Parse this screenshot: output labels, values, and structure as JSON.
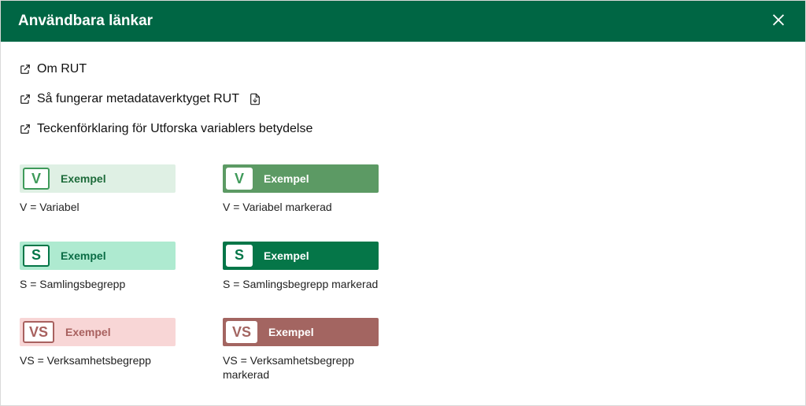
{
  "header": {
    "title": "Användbara länkar"
  },
  "links": [
    {
      "label": "Om RUT",
      "has_pdf": false
    },
    {
      "label": "Så fungerar metadataverktyget RUT",
      "has_pdf": true
    },
    {
      "label": "Teckenförklaring för Utforska variablers betydelse",
      "has_pdf": false
    }
  ],
  "legend": {
    "rows": [
      {
        "key": "v",
        "normal": {
          "letter": "V",
          "example": "Exempel",
          "caption": "V = Variabel"
        },
        "selected": {
          "letter": "V",
          "example": "Exempel",
          "caption": "V = Variabel markerad"
        }
      },
      {
        "key": "s",
        "normal": {
          "letter": "S",
          "example": "Exempel",
          "caption": "S = Samlingsbegrepp"
        },
        "selected": {
          "letter": "S",
          "example": "Exempel",
          "caption": "S = Samlingsbegrepp markerad"
        }
      },
      {
        "key": "vs",
        "normal": {
          "letter": "VS",
          "example": "Exempel",
          "caption": "VS = Verksamhetsbegrepp"
        },
        "selected": {
          "letter": "VS",
          "example": "Exempel",
          "caption": "VS = Verksamhetsbegrepp markerad"
        }
      }
    ]
  }
}
